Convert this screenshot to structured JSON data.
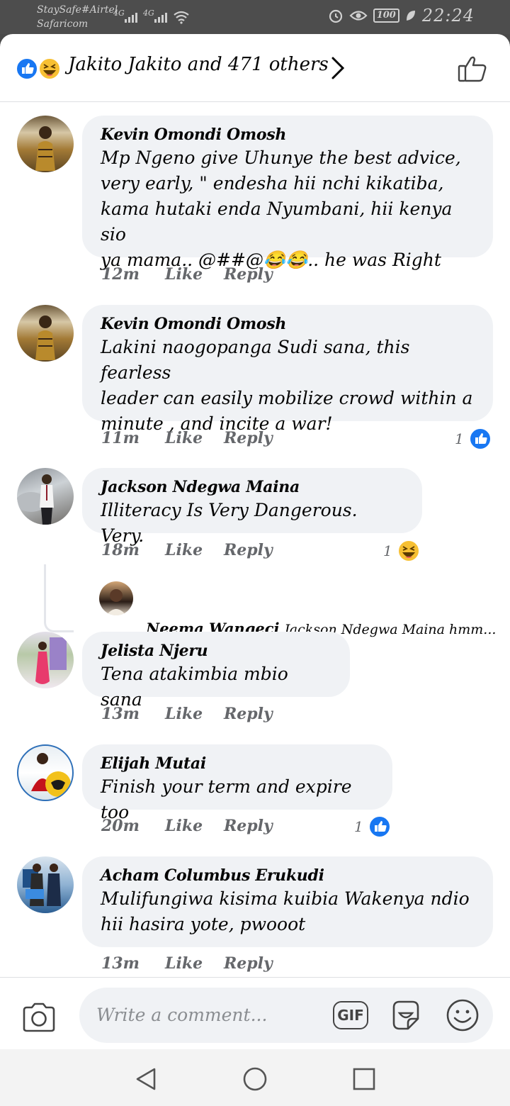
{
  "status_bar": {
    "carrier1": "StaySafe#Airtel",
    "carrier2": "Safaricom",
    "network1": "4G",
    "network2": "4G",
    "battery": "100",
    "time": "22:24"
  },
  "header": {
    "likers_text": "Jakito Jakito and 471 others",
    "icons": [
      "like-reaction-icon",
      "haha-reaction-icon",
      "chevron-right-icon",
      "thumbs-up-outline-icon"
    ]
  },
  "comments": [
    {
      "name": "Kevin Omondi Omosh",
      "lines": [
        "Mp Ngeno give Uhunye the best advice,",
        "very early, \" endesha hii nchi kikatiba,",
        "kama hutaki enda Nyumbani, hii kenya sio",
        "ya mama.. @##@😂😂.. he was Right"
      ],
      "time": "12m",
      "like": "Like",
      "reply": "Reply"
    },
    {
      "name": "Kevin Omondi Omosh",
      "lines": [
        "Lakini naogopanga Sudi sana, this fearless",
        "leader can easily mobilize crowd within a",
        "minute , and incite a war!"
      ],
      "time": "11m",
      "like": "Like",
      "reply": "Reply",
      "reaction_count": "1",
      "reaction": "like"
    },
    {
      "name": "Jackson Ndegwa Maina",
      "lines": [
        "Illiteracy Is Very Dangerous.  Very."
      ],
      "time": "18m",
      "like": "Like",
      "reply": "Reply",
      "reaction_count": "1",
      "reaction": "haha",
      "reply_preview": {
        "name": "Neema Wangeci",
        "text": "Jackson Ndegwa Maina hmm..."
      }
    },
    {
      "name": "Jelista Njeru",
      "lines": [
        "Tena atakimbia mbio sana"
      ],
      "time": "13m",
      "like": "Like",
      "reply": "Reply"
    },
    {
      "name": "Elijah Mutai",
      "lines": [
        "Finish your term and expire too"
      ],
      "time": "20m",
      "like": "Like",
      "reply": "Reply",
      "reaction_count": "1",
      "reaction": "like"
    },
    {
      "name": "Acham Columbus Erukudi",
      "lines": [
        "Mulifungiwa kisima kuibia Wakenya ndio",
        "hii hasira yote, pwooot"
      ],
      "time": "13m",
      "like": "Like",
      "reply": "Reply"
    }
  ],
  "composer": {
    "placeholder": "Write a comment...",
    "gif_label": "GIF",
    "icons": [
      "camera-icon",
      "sticker-icon",
      "emoji-icon"
    ]
  },
  "navbar": {
    "icons": [
      "back-triangle-icon",
      "home-circle-icon",
      "recents-square-icon"
    ]
  },
  "colors": {
    "facebook_blue": "#1877f2",
    "bubble_bg": "#f0f2f5",
    "meta_gray": "#65676b",
    "haha_yellow": "#f7c033"
  }
}
